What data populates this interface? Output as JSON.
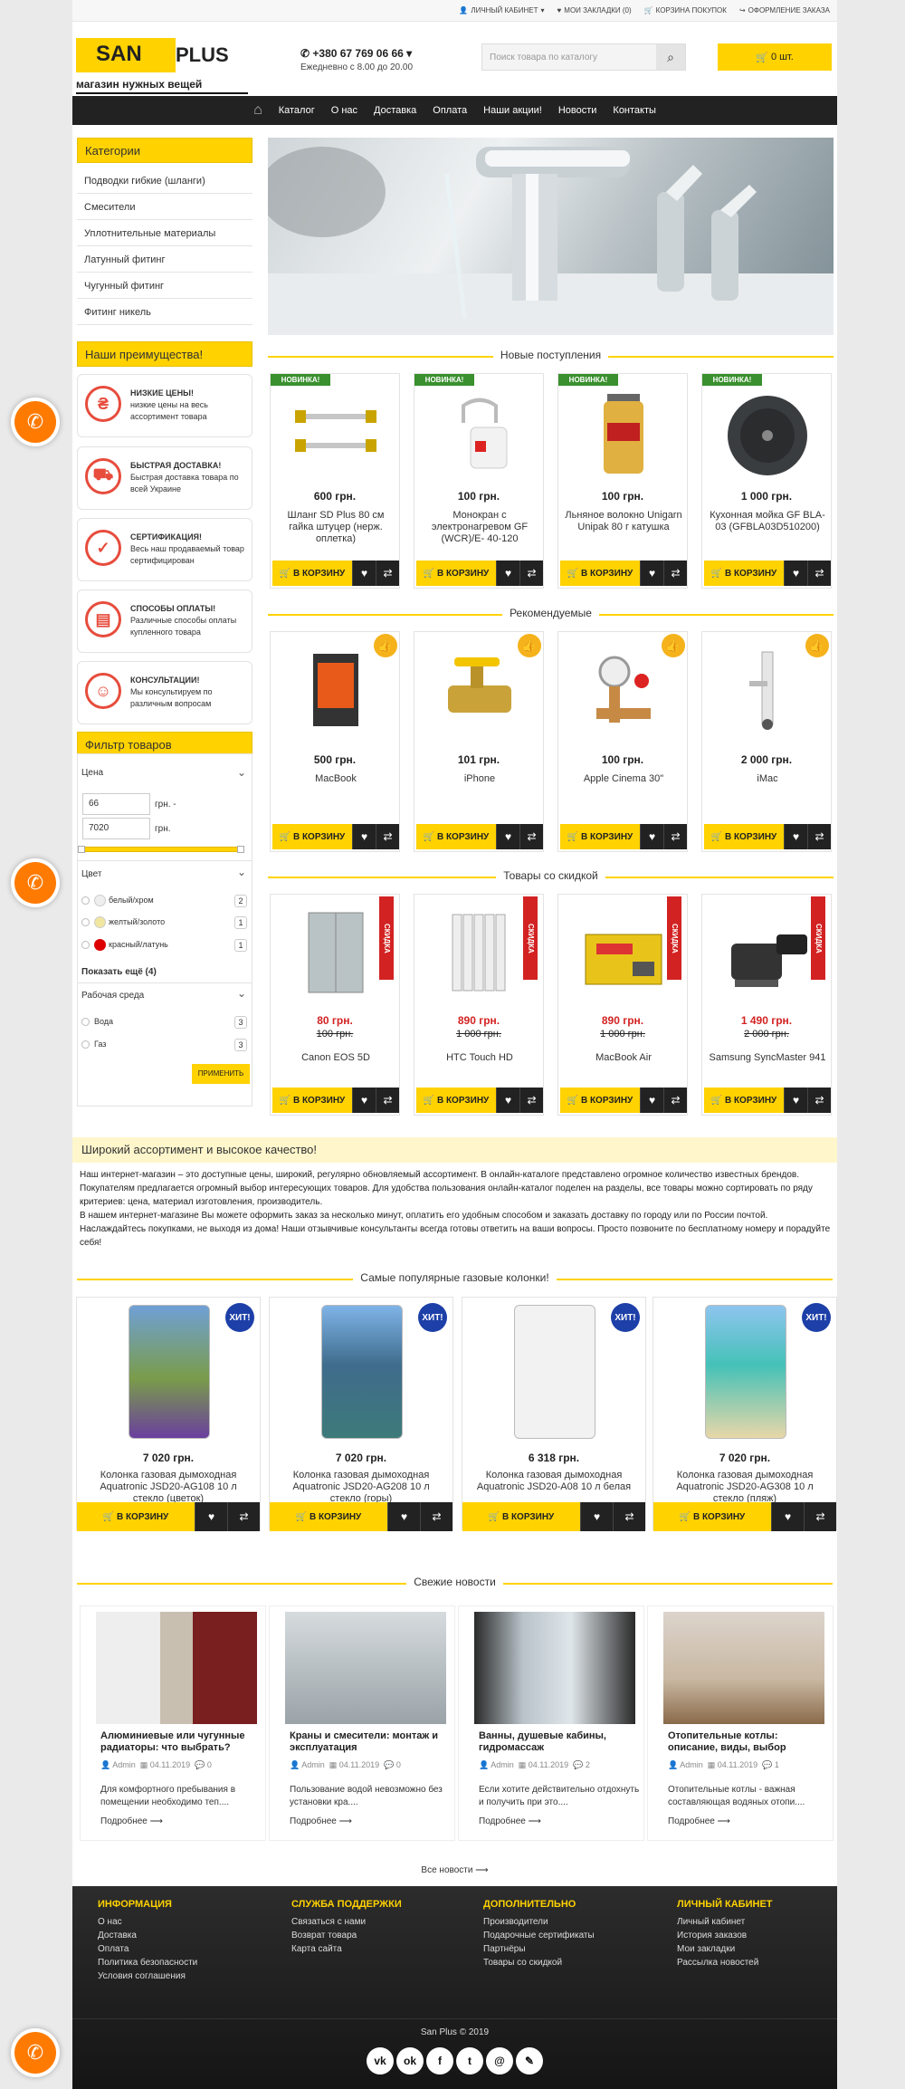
{
  "topbar": {
    "account": "ЛИЧНЫЙ КАБИНЕТ",
    "bookmarks": "МОИ ЗАКЛАДКИ (0)",
    "cart": "КОРЗИНА ПОКУПОК",
    "checkout": "ОФОРМЛЕНИЕ ЗАКАЗА"
  },
  "header": {
    "logo_part1": "SAN",
    "logo_part2": "PLUS",
    "slogan": "магазин нужных вещей",
    "phone": "+380 67 769 06 66",
    "hours": "Ежедневно с 8.00 до 20.00",
    "search_placeholder": "Поиск товара по каталогу",
    "cart_label": "0 шт."
  },
  "nav": [
    "Каталог",
    "О нас",
    "Доставка",
    "Оплата",
    "Наши акции!",
    "Новости",
    "Контакты"
  ],
  "sidebar": {
    "categories_title": "Категории",
    "categories": [
      "Подводки гибкие (шланги)",
      "Смесители",
      "Уплотнительные материалы",
      "Латунный фитинг",
      "Чугунный фитинг",
      "Фитинг никель"
    ],
    "advantages_title": "Наши преимущества!",
    "advantages": [
      {
        "title": "НИЗКИЕ ЦЕНЫ!",
        "text": "низкие цены на весь ассортимент товара"
      },
      {
        "title": "БЫСТРАЯ ДОСТАВКА!",
        "text": "Быстрая доставка товара по всей Украине"
      },
      {
        "title": "СЕРТИФИКАЦИЯ!",
        "text": "Весь наш продаваемый товар сертифицирован"
      },
      {
        "title": "СПОСОБЫ ОПЛАТЫ!",
        "text": "Различные способы оплаты купленного товара"
      },
      {
        "title": "КОНСУЛЬТАЦИИ!",
        "text": "Мы консультируем по различным вопросам"
      }
    ],
    "filter_title": "Фильтр товаров",
    "filter": {
      "price_label": "Цена",
      "price_min": "66",
      "price_max": "7020",
      "currency_from": "грн. -",
      "currency_to": "грн.",
      "color_label": "Цвет",
      "colors": [
        {
          "name": "белый/хром",
          "count": "2",
          "swatch": "#eeeeee"
        },
        {
          "name": "желтый/золото",
          "count": "1",
          "swatch": "#f1e6a0"
        },
        {
          "name": "красный/латунь",
          "count": "1",
          "swatch": "#dd0000"
        }
      ],
      "show_more": "Показать ещё (4)",
      "medium_label": "Рабочая среда",
      "mediums": [
        {
          "name": "Вода",
          "count": "3"
        },
        {
          "name": "Газ",
          "count": "3"
        }
      ],
      "apply": "ПРИМЕНИТЬ"
    }
  },
  "labels": {
    "to_cart": "В КОРЗИНУ",
    "new_badge": "НОВИНКА!",
    "sale_badge": "СКИДКА",
    "hit_badge": "ХИТ!"
  },
  "sections": {
    "new": "Новые поступления",
    "recommended": "Рекомендуемые",
    "sale": "Товары со скидкой",
    "gas": "Самые популярные газовые колонки!",
    "news": "Свежие новости"
  },
  "new_products": [
    {
      "price": "600 грн.",
      "name": "Шланг SD Plus 80 см гайка штуцер (нерж. оплетка)"
    },
    {
      "price": "100 грн.",
      "name": "Монокран с электронагревом GF (WCR)/E- 40-120"
    },
    {
      "price": "100 грн.",
      "name": "Льняное волокно Unigarn Unipak 80 г катушка"
    },
    {
      "price": "1 000 грн.",
      "name": "Кухонная мойка GF BLA-03 (GFBLA03D510200)"
    }
  ],
  "recommended_products": [
    {
      "price": "500 грн.",
      "name": "MacBook"
    },
    {
      "price": "101 грн.",
      "name": "iPhone"
    },
    {
      "price": "100 грн.",
      "name": "Apple Cinema 30\""
    },
    {
      "price": "2 000 грн.",
      "name": "iMac"
    }
  ],
  "sale_products": [
    {
      "price": "80 грн.",
      "old": "100 грн.",
      "name": "Canon EOS 5D"
    },
    {
      "price": "890 грн.",
      "old": "1 000 грн.",
      "name": "HTC Touch HD"
    },
    {
      "price": "890 грн.",
      "old": "1 000 грн.",
      "name": "MacBook Air"
    },
    {
      "price": "1 490 грн.",
      "old": "2 000 грн.",
      "name": "Samsung SyncMaster 941"
    }
  ],
  "info": {
    "title": "Широкий ассортимент и высокое качество!",
    "p1": "Наш интернет-магазин – это доступные цены, широкий, регулярно обновляемый ассортимент. В онлайн-каталоге представлено огромное количество известных брендов. Покупателям предлагается огромный выбор интересующих товаров. Для удобства пользования онлайн-каталог поделен на разделы, все товары можно сортировать по ряду критериев: цена, материал изготовления, производитель.",
    "p2": "В нашем интернет-магазине Вы можете оформить заказ за несколько минут, оплатить его удобным способом и заказать доставку по городу или по России почтой. Наслаждайтесь покупками, не выходя из дома! Наши отзывчивые консультанты всегда готовы ответить на ваши вопросы. Просто позвоните по бесплатному номеру и порадуйте себя!"
  },
  "gas_products": [
    {
      "price": "7 020 грн.",
      "name": "Колонка газовая дымоходная Aquatronic JSD20-AG108 10 л стекло (цветок)"
    },
    {
      "price": "7 020 грн.",
      "name": "Колонка газовая дымоходная Aquatronic JSD20-AG208 10 л стекло (горы)"
    },
    {
      "price": "6 318 грн.",
      "name": "Колонка газовая дымоходная Aquatronic JSD20-A08 10 л белая"
    },
    {
      "price": "7 020 грн.",
      "name": "Колонка газовая дымоходная Aquatronic JSD20-AG308 10 л стекло (пляж)"
    }
  ],
  "news": [
    {
      "title": "Алюминиевые или чугунные радиаторы: что выбрать?",
      "author": "Admin",
      "date": "04.11.2019",
      "comments": "0",
      "excerpt": "Для комфортного пребывания в помещении необходимо теп....",
      "more": "Подробнее"
    },
    {
      "title": "Краны и смесители: монтаж и эксплуатация",
      "author": "Admin",
      "date": "04.11.2019",
      "comments": "0",
      "excerpt": "Пользование водой невозможно без установки кра....",
      "more": "Подробнее"
    },
    {
      "title": "Ванны, душевые кабины, гидромассаж",
      "author": "Admin",
      "date": "04.11.2019",
      "comments": "2",
      "excerpt": "Если хотите действительно отдохнуть и получить при это....",
      "more": "Подробнее"
    },
    {
      "title": "Отопительные котлы: описание, виды, выбор",
      "author": "Admin",
      "date": "04.11.2019",
      "comments": "1",
      "excerpt": "Отопительные котлы - важная составляющая водяных отопи....",
      "more": "Подробнее"
    }
  ],
  "all_news": "Все новости",
  "footer": {
    "cols": [
      {
        "title": "ИНФОРМАЦИЯ",
        "items": [
          "О нас",
          "Доставка",
          "Оплата",
          "Политика безопасности",
          "Условия соглашения"
        ]
      },
      {
        "title": "СЛУЖБА ПОДДЕРЖКИ",
        "items": [
          "Связаться с нами",
          "Возврат товара",
          "Карта сайта"
        ]
      },
      {
        "title": "ДОПОЛНИТЕЛЬНО",
        "items": [
          "Производители",
          "Подарочные сертификаты",
          "Партнёры",
          "Товары со скидкой"
        ]
      },
      {
        "title": "ЛИЧНЫЙ КАБИНЕТ",
        "items": [
          "Личный кабинет",
          "История заказов",
          "Мои закладки",
          "Рассылка новостей"
        ]
      }
    ],
    "copyright": "San Plus © 2019",
    "social": [
      "vk-icon",
      "odnoklassniki-icon",
      "facebook-icon",
      "twitter-icon",
      "email-icon",
      "link-icon"
    ]
  },
  "colors": {
    "accent": "#ffd200",
    "dark": "#222222",
    "call": "#ff7a00"
  }
}
